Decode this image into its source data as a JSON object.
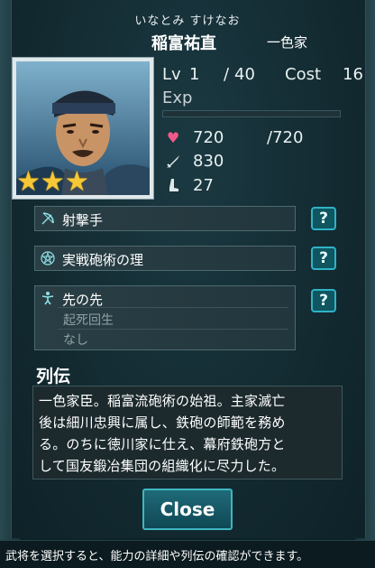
{
  "header": {
    "reading": "いなとみ すけなお",
    "name": "稲富祐直",
    "clan": "一色家"
  },
  "card": {
    "rarity_stars": 3,
    "star_glyph": "★"
  },
  "level": {
    "label": "Lv",
    "current": "1",
    "separator": "/",
    "max": "40",
    "cost_label": "Cost",
    "cost": "16"
  },
  "exp": {
    "label": "Exp",
    "progress": 0
  },
  "stats": {
    "hp_icon": "heart-icon",
    "hp": "720",
    "hp_max": "/720",
    "attack_icon": "sword-icon",
    "attack": "830",
    "speed_icon": "boot-icon",
    "speed": "27"
  },
  "skills": [
    {
      "icon": "bow-icon",
      "label": "射撃手",
      "help": "?"
    },
    {
      "icon": "pentagram-icon",
      "label": "実戦砲術の理",
      "help": "?"
    },
    {
      "icon": "figure-icon",
      "label": "先の先",
      "help": "?",
      "sub": [
        "起死回生",
        "なし"
      ]
    }
  ],
  "biography": {
    "title": "列伝",
    "lines": [
      "一色家臣。稲富流砲術の始祖。主家滅亡",
      "後は細川忠興に属し、鉄砲の師範を務め",
      "る。のちに徳川家に仕え、幕府鉄砲方と",
      "して国友鍛冶集団の組織化に尽力した。"
    ]
  },
  "close_label": "Close",
  "footer": "武将を選択すると、能力の詳細や列伝の確認ができます。",
  "colors": {
    "accent": "#2fb3c6",
    "star": "#f6c836",
    "heart": "#f05a8a"
  }
}
